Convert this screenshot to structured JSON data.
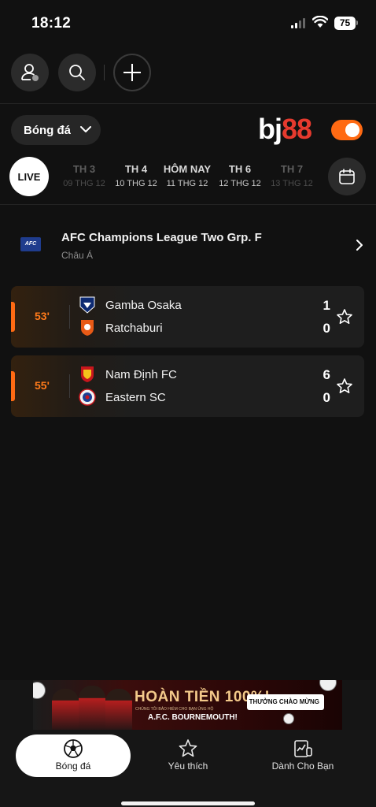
{
  "status_bar": {
    "time": "18:12",
    "battery": "75"
  },
  "top_bar": {
    "user_icon": "user-icon",
    "search_icon": "search-icon",
    "add_icon": "plus-icon"
  },
  "header": {
    "sport": "Bóng đá",
    "brand_part1": "bj",
    "brand_part2": "88",
    "toggle_on": true,
    "accent_color": "#ff6a13"
  },
  "date_nav": {
    "live_label": "LIVE",
    "days": [
      {
        "name": "TH 3",
        "date": "09 THG 12"
      },
      {
        "name": "TH 4",
        "date": "10 THG 12"
      },
      {
        "name": "HÔM NAY",
        "date": "11 THG 12"
      },
      {
        "name": "TH 6",
        "date": "12 THG 12"
      },
      {
        "name": "TH 7",
        "date": "13 THG 12"
      }
    ]
  },
  "league": {
    "logo_text": "AFC",
    "name": "AFC Champions League Two Grp. F",
    "region": "Châu Á"
  },
  "matches": [
    {
      "minute": "53'",
      "home": {
        "name": "Gamba Osaka",
        "score": "1"
      },
      "away": {
        "name": "Ratchaburi",
        "score": "0"
      }
    },
    {
      "minute": "55'",
      "home": {
        "name": "Nam Định FC",
        "score": "6"
      },
      "away": {
        "name": "Eastern SC",
        "score": "0"
      }
    }
  ],
  "banner": {
    "title": "HOÀN TIỀN 100%!",
    "subtitle": "CHÚNG TÔI BẢO HIỂM CHO BẠN ỦNG HỘ",
    "club": "A.F.C. BOURNEMOUTH!",
    "badge": "THƯỞNG CHÀO MỪNG"
  },
  "tabs": [
    {
      "label": "Bóng đá",
      "icon": "soccer-ball-icon"
    },
    {
      "label": "Yêu thích",
      "icon": "star-icon"
    },
    {
      "label": "Dành Cho Bạn",
      "icon": "personalized-icon"
    }
  ]
}
